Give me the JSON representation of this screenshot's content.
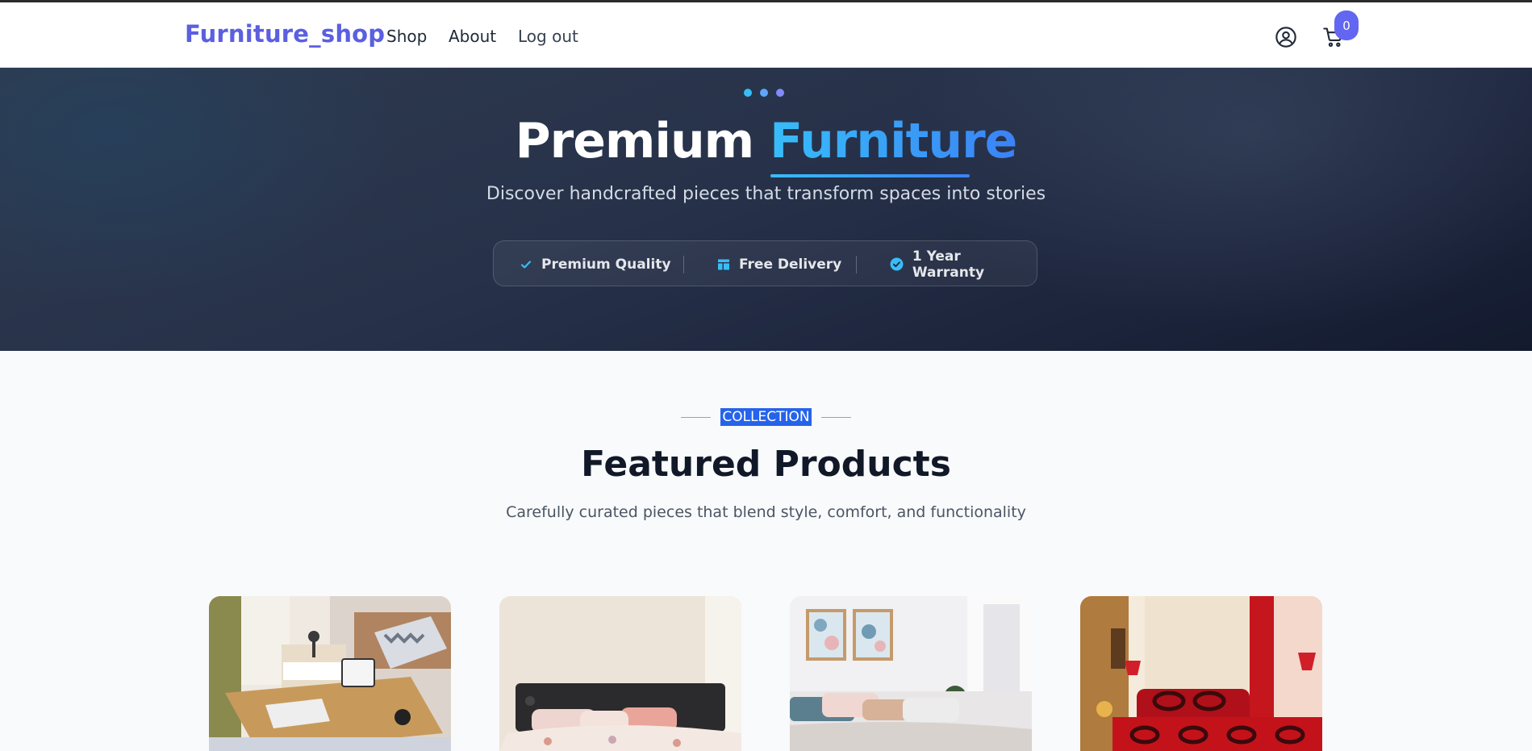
{
  "navbar": {
    "brand": "Furniture_shop",
    "links": [
      {
        "label": "Shop"
      },
      {
        "label": "About"
      },
      {
        "label": "Log out"
      }
    ],
    "user_icon": "user-circle-icon",
    "cart_icon": "cart-icon",
    "cart_count": "0",
    "brand_color": "#5b5fe0",
    "badge_color": "#6366f1"
  },
  "hero": {
    "title_main": "Premium",
    "title_accent": "Furniture",
    "subtitle": "Discover handcrafted pieces that transform spaces into stories",
    "features": [
      {
        "label": "Premium Quality",
        "icon": "check-icon"
      },
      {
        "label": "Free Delivery",
        "icon": "layout-icon"
      },
      {
        "label": "1 Year Warranty",
        "icon": "badge-check-icon"
      }
    ],
    "accent_color": "#38bdf8"
  },
  "collection": {
    "eyebrow": "COLLECTION",
    "title": "Featured Products",
    "subtitle": "Carefully curated pieces that blend style, comfort, and functionality"
  },
  "products": [
    {
      "image": "laptop-bed-desk-photo"
    },
    {
      "image": "black-headboard-bed-photo"
    },
    {
      "image": "white-bedroom-photo"
    },
    {
      "image": "red-bedroom-photo"
    }
  ]
}
